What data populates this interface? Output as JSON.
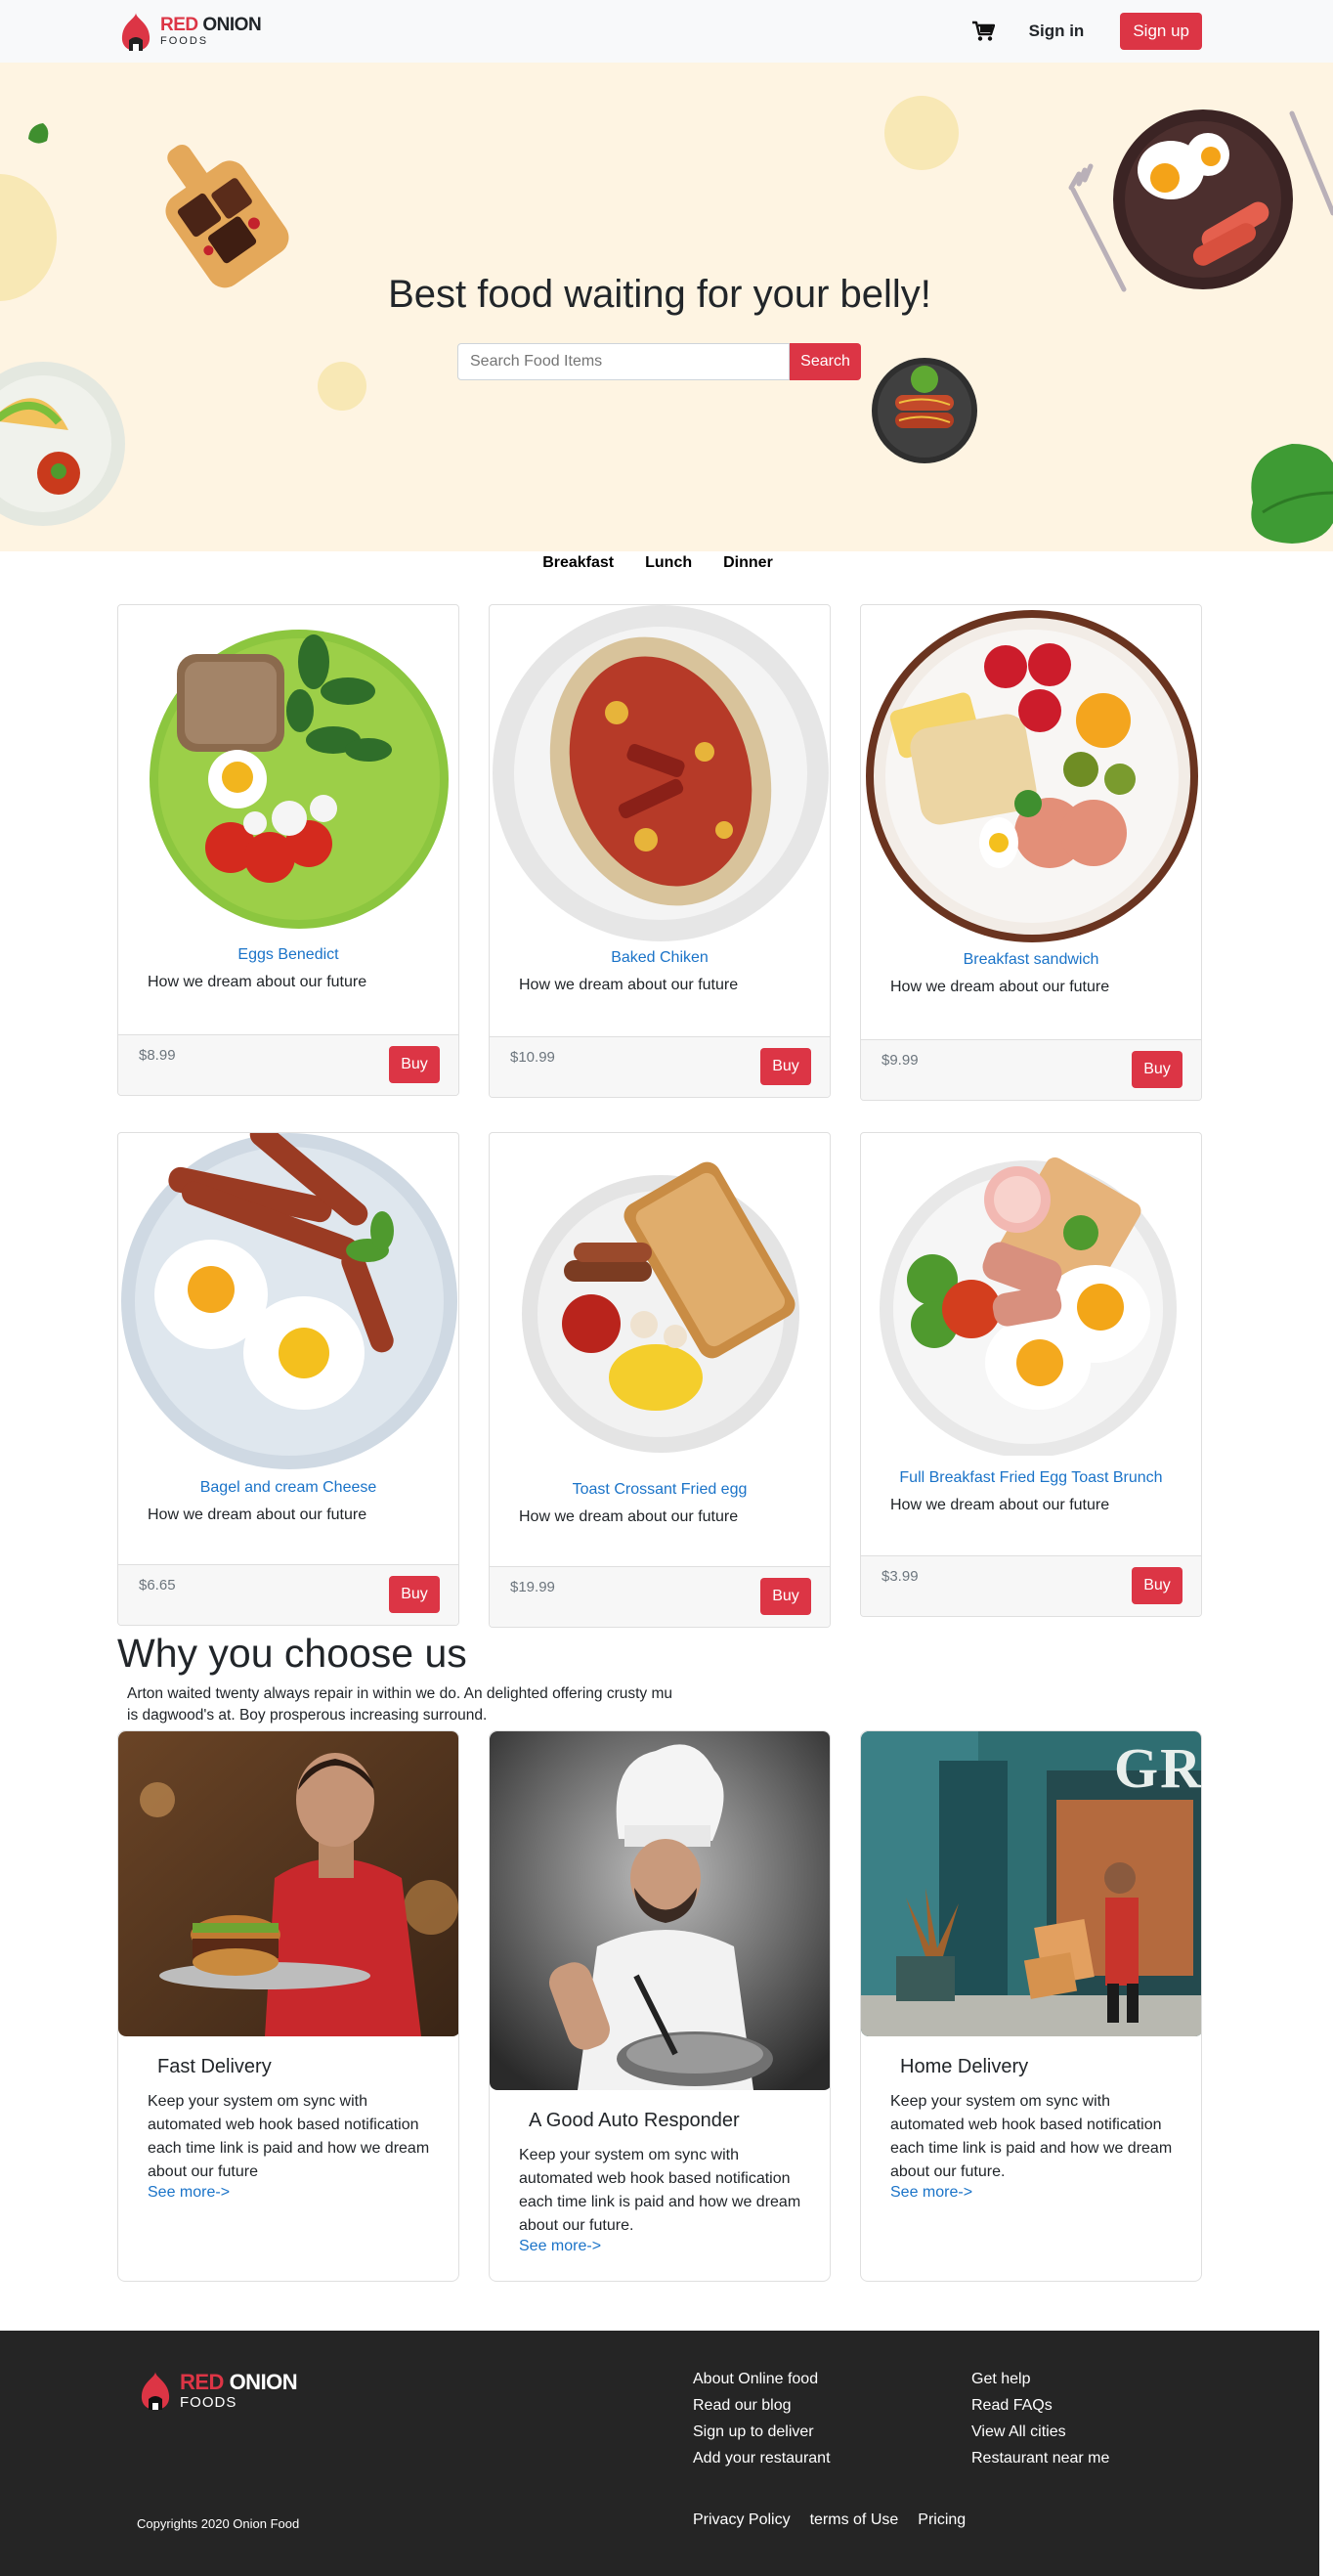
{
  "brand": {
    "name_red": "RED",
    "name_rest": " ONION",
    "sub": "FOODS"
  },
  "nav": {
    "signin": "Sign in",
    "signup": "Sign up",
    "cart_icon": "cart-icon"
  },
  "hero": {
    "title": "Best food waiting for your belly!",
    "search_placeholder": "Search Food Items",
    "search_button": "Search"
  },
  "tabs": [
    "Breakfast",
    "Lunch",
    "Dinner"
  ],
  "foods": [
    {
      "name": "Eggs Benedict",
      "desc": "How we dream about our future",
      "price": "$8.99",
      "buy": "Buy"
    },
    {
      "name": "Baked Chiken",
      "desc": "How we dream about our future",
      "price": "$10.99",
      "buy": "Buy"
    },
    {
      "name": "Breakfast sandwich",
      "desc": "How we dream about our future",
      "price": "$9.99",
      "buy": "Buy"
    },
    {
      "name": "Bagel and cream Cheese",
      "desc": "How we dream about our future",
      "price": "$6.65",
      "buy": "Buy"
    },
    {
      "name": "Toast Crossant Fried egg",
      "desc": "How we dream about our future",
      "price": "$19.99",
      "buy": "Buy"
    },
    {
      "name": "Full Breakfast Fried Egg Toast Brunch",
      "desc": "How we dream about our future",
      "price": "$3.99",
      "buy": "Buy"
    }
  ],
  "why": {
    "title": "Why you choose us",
    "text": "Arton waited twenty always repair in within we do. An delighted offering crusty mu is dagwood's at. Boy prosperous increasing surround.",
    "features": [
      {
        "title": "Fast Delivery",
        "text": "Keep your system om sync with automated web hook based notification each time link is paid and how we dream about our future",
        "link": "See more->"
      },
      {
        "title": "A Good Auto Responder",
        "text": "Keep your system om sync with automated web hook based notification each time link is paid and how we dream about our future.",
        "link": "See more->"
      },
      {
        "title": "Home Delivery",
        "text": "Keep your system om sync with automated web hook based notification each time link is paid and how we dream about our future.",
        "link": "See more->"
      }
    ]
  },
  "footer": {
    "col1": [
      "About Online food",
      "Read our blog",
      "Sign up to deliver",
      "Add your restaurant"
    ],
    "col2": [
      "Get help",
      "Read FAQs",
      "View All cities",
      "Restaurant near me"
    ],
    "copyright": "Copyrights 2020 Onion Food",
    "bottom_links": [
      "Privacy Policy",
      "terms of Use",
      "Pricing"
    ]
  },
  "colors": {
    "accent": "#dc3545",
    "link": "#1a73c8",
    "hero_bg": "#fef4e2",
    "footer_bg": "#252525"
  }
}
